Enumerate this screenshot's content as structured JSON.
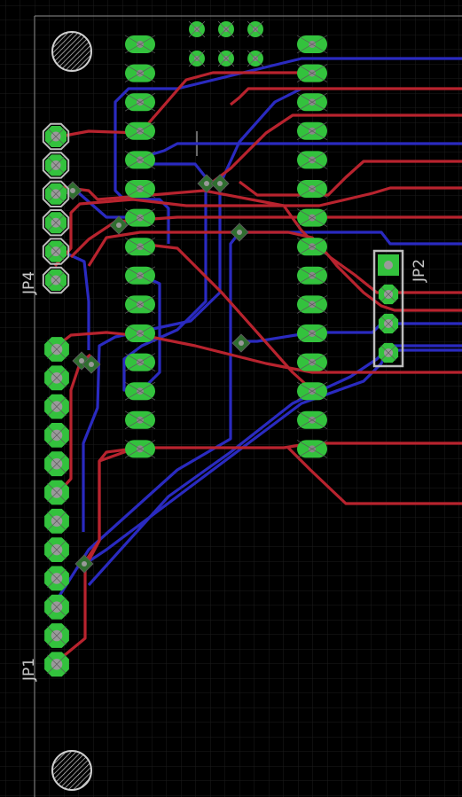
{
  "labels": {
    "jp1": "JP1",
    "jp2": "JP2",
    "jp4": "JP4"
  },
  "colors": {
    "background": "#000000",
    "grid": "#1e1e1e",
    "top_copper": "#b3232e",
    "bottom_copper": "#2424b8",
    "pad": "#2fbf3a",
    "pad_hole": "#8a8a8a",
    "via": "#3aa34a",
    "silkscreen": "#c8c8c8",
    "board_outline": "#9a9a9a"
  },
  "icons": {
    "mounting_hole": "hatched-circle-icon",
    "origin_marker": "crosshair-icon"
  }
}
